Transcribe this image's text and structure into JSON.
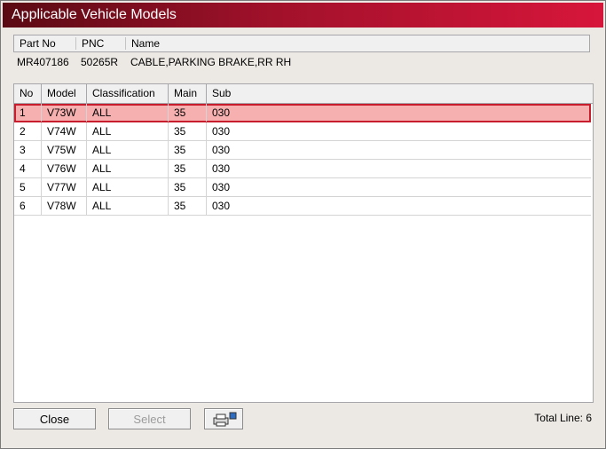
{
  "window": {
    "title": "Applicable Vehicle Models"
  },
  "part": {
    "headers": [
      "Part No",
      "PNC",
      "Name"
    ],
    "values": [
      "MR407186",
      "50265R",
      "CABLE,PARKING BRAKE,RR RH"
    ]
  },
  "table": {
    "headers": [
      "No",
      "Model",
      "Classification",
      "Main",
      "Sub"
    ],
    "rows": [
      [
        "1",
        "V73W",
        "ALL",
        "35",
        "030"
      ],
      [
        "2",
        "V74W",
        "ALL",
        "35",
        "030"
      ],
      [
        "3",
        "V75W",
        "ALL",
        "35",
        "030"
      ],
      [
        "4",
        "V76W",
        "ALL",
        "35",
        "030"
      ],
      [
        "5",
        "V77W",
        "ALL",
        "35",
        "030"
      ],
      [
        "6",
        "V78W",
        "ALL",
        "35",
        "030"
      ]
    ],
    "selected_row": 0
  },
  "buttons": {
    "close": "Close",
    "select": "Select",
    "print_icon": "printer-icon"
  },
  "status": {
    "total_line": "Total Line: 6"
  },
  "colors": {
    "title_start": "#5a0a14",
    "title_end": "#d7163b",
    "selected_fill": "#f7b0b0",
    "selected_border": "#c81d2c"
  }
}
